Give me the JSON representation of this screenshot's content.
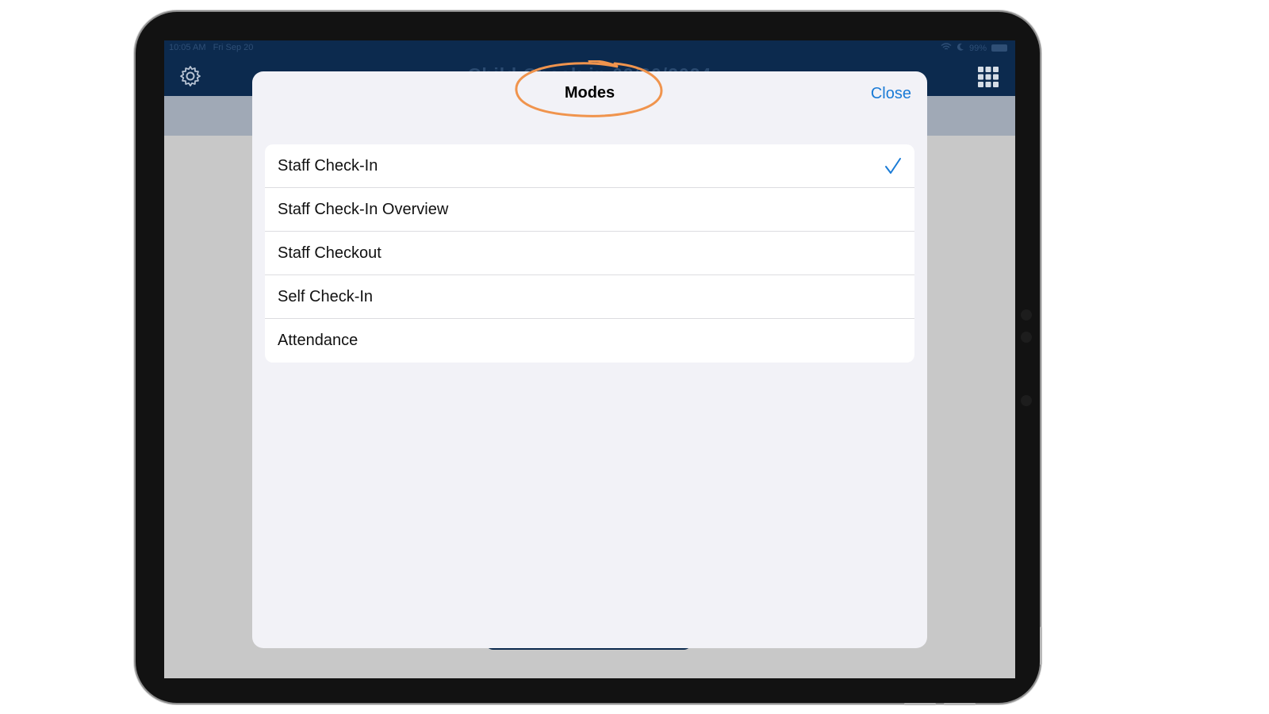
{
  "status_bar": {
    "time": "10:05 AM",
    "date": "Fri Sep 20",
    "battery": "99%"
  },
  "header": {
    "title": "Child Check-in 09/20/2024"
  },
  "modal": {
    "title": "Modes",
    "close_label": "Close",
    "items": [
      {
        "label": "Staff Check-In",
        "selected": true
      },
      {
        "label": "Staff Check-In Overview",
        "selected": false
      },
      {
        "label": "Staff Checkout",
        "selected": false
      },
      {
        "label": "Self Check-In",
        "selected": false
      },
      {
        "label": "Attendance",
        "selected": false
      }
    ]
  },
  "colors": {
    "accent": "#1a7bd6",
    "nav_bg": "#0c2a4e",
    "annotation": "#f0944d"
  },
  "icons": [
    "gear-icon",
    "grid-icon",
    "checkmark-icon",
    "wifi-icon",
    "moon-icon",
    "battery-icon"
  ]
}
